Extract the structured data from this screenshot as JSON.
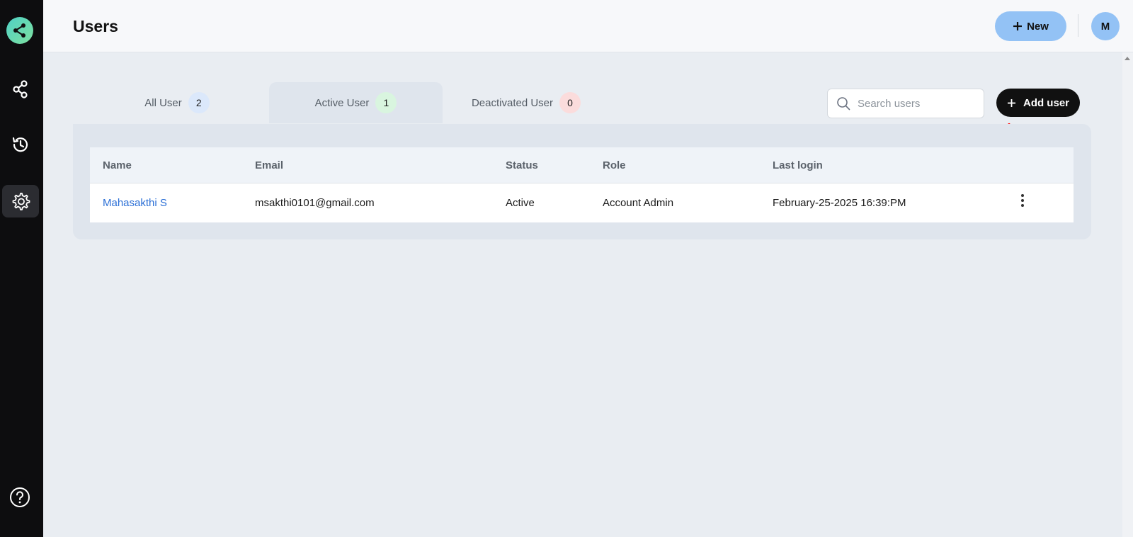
{
  "header": {
    "title": "Users",
    "new_button_label": "New",
    "avatar_initial": "M"
  },
  "sidebar": {
    "items": [
      {
        "icon": "share-icon",
        "label": ""
      },
      {
        "icon": "history-icon",
        "label": ""
      },
      {
        "icon": "gear-icon",
        "label": "",
        "active": true
      }
    ],
    "help_icon": "help-circle-icon"
  },
  "tabs": [
    {
      "label": "All User",
      "count": "2",
      "badge_color": "#dbe8fb"
    },
    {
      "label": "Active User",
      "count": "1",
      "badge_color": "#d9f5df",
      "active": true
    },
    {
      "label": "Deactivated User",
      "count": "0",
      "badge_color": "#fbdcdc"
    }
  ],
  "search": {
    "placeholder": "Search users",
    "value": ""
  },
  "add_user_button_label": "Add user",
  "table": {
    "columns": [
      "Name",
      "Email",
      "Status",
      "Role",
      "Last login"
    ],
    "rows": [
      {
        "name": "Mahasakthi S",
        "email": "msakthi0101@gmail.com",
        "status": "Active",
        "role": "Account Admin",
        "last_login": "February-25-2025 16:39:PM"
      }
    ]
  },
  "colors": {
    "accent": "#93c2f5",
    "sidebar_bg": "#0d0d0f",
    "link": "#2b6fd6",
    "annotation": "#ff0000"
  }
}
